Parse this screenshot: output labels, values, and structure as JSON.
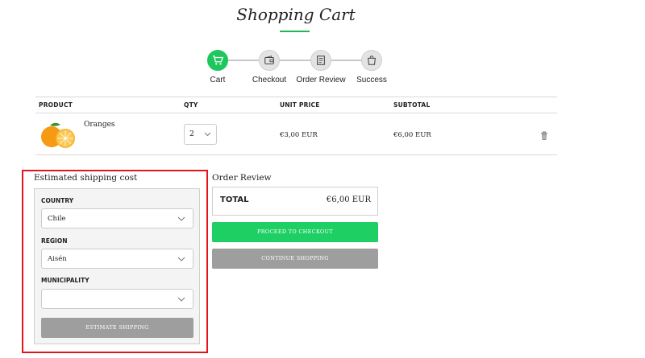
{
  "page_title": "Shopping Cart",
  "steps": [
    {
      "label": "Cart",
      "icon": "cart-icon",
      "active": true
    },
    {
      "label": "Checkout",
      "icon": "wallet-icon",
      "active": false
    },
    {
      "label": "Order Review",
      "icon": "receipt-icon",
      "active": false
    },
    {
      "label": "Success",
      "icon": "shopping-bag-icon",
      "active": false
    }
  ],
  "table": {
    "headers": {
      "product": "PRODUCT",
      "qty": "QTY",
      "unit_price": "UNIT PRICE",
      "subtotal": "SUBTOTAL"
    },
    "rows": [
      {
        "product": "Oranges",
        "qty": "2",
        "unit_price": "€3,00 EUR",
        "subtotal": "€6,00 EUR"
      }
    ]
  },
  "shipping": {
    "title": "Estimated shipping cost",
    "country_label": "COUNTRY",
    "country_value": "Chile",
    "region_label": "REGION",
    "region_value": "Aisén",
    "municipality_label": "MUNICIPALITY",
    "municipality_value": "",
    "estimate_button": "ESTIMATE SHIPPING"
  },
  "review": {
    "title": "Order Review",
    "total_label": "TOTAL",
    "total_value": "€6,00 EUR",
    "checkout_button": "PROCEED TO CHECKOUT",
    "continue_button": "CONTINUE SHOPPING"
  },
  "colors": {
    "accent": "#1ec75d",
    "highlight": "#e5141a",
    "button_gray": "#9e9e9e"
  }
}
